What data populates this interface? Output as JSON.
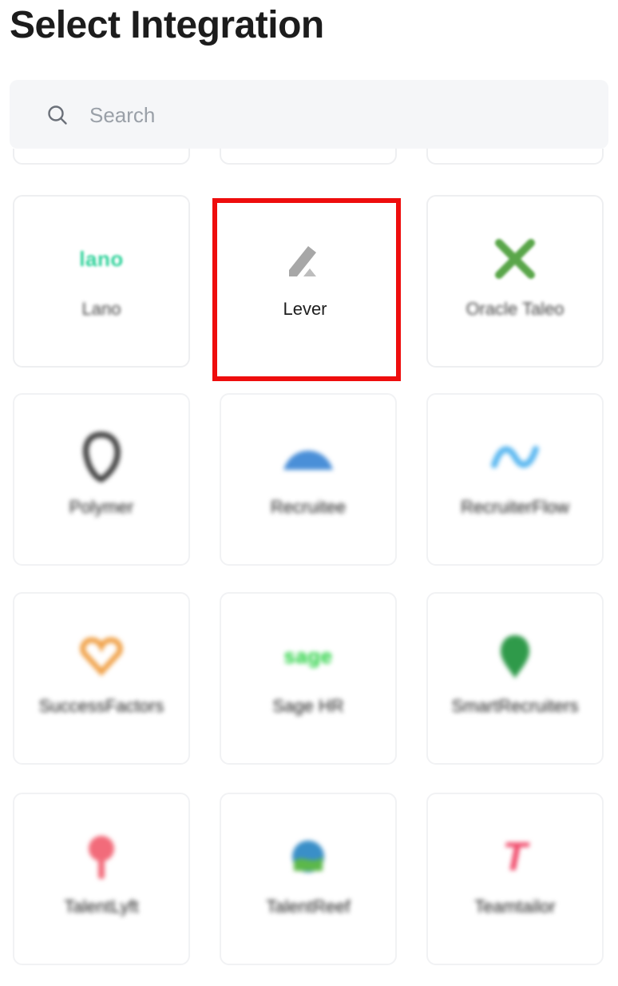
{
  "page": {
    "title": "Select Integration"
  },
  "search": {
    "placeholder": "Search",
    "value": ""
  },
  "integrations": [
    {
      "label": "Lano",
      "logo_text": "lano",
      "logo_color": "#2fd29a",
      "icon": "lano-logo-icon"
    },
    {
      "label": "Lever",
      "icon": "lever-logo-icon",
      "logo_color": "#9a9a9a",
      "selected": true
    },
    {
      "label": "Oracle Taleo",
      "icon": "oracle-taleo-logo-icon",
      "logo_color": "#5aa64a"
    },
    {
      "label": "Polymer",
      "icon": "polymer-logo-icon",
      "logo_color": "#3a3a3a"
    },
    {
      "label": "Recruitee",
      "icon": "recruitee-logo-icon",
      "logo_color": "#4a8fd8"
    },
    {
      "label": "RecruiterFlow",
      "icon": "recruiterflow-logo-icon",
      "logo_color": "#5cb8f0"
    },
    {
      "label": "SuccessFactors",
      "icon": "successfactors-logo-icon",
      "logo_color": "#f0a24a"
    },
    {
      "label": "Sage HR",
      "logo_text": "sage",
      "icon": "sage-logo-icon",
      "logo_color": "#1fcf3a"
    },
    {
      "label": "SmartRecruiters",
      "icon": "smartrecruiters-logo-icon",
      "logo_color": "#2f9a4a"
    },
    {
      "label": "TalentLyft",
      "icon": "talentlyft-logo-icon",
      "logo_color": "#f26b7a"
    },
    {
      "label": "TalentReef",
      "icon": "talentreef-logo-icon",
      "logo_color": "#3a8fc8"
    },
    {
      "label": "Teamtailor",
      "logo_text": "T",
      "icon": "teamtailor-logo-icon",
      "logo_color": "#f04a6a"
    }
  ],
  "selection": {
    "outline_color": "#ee0d0d"
  }
}
